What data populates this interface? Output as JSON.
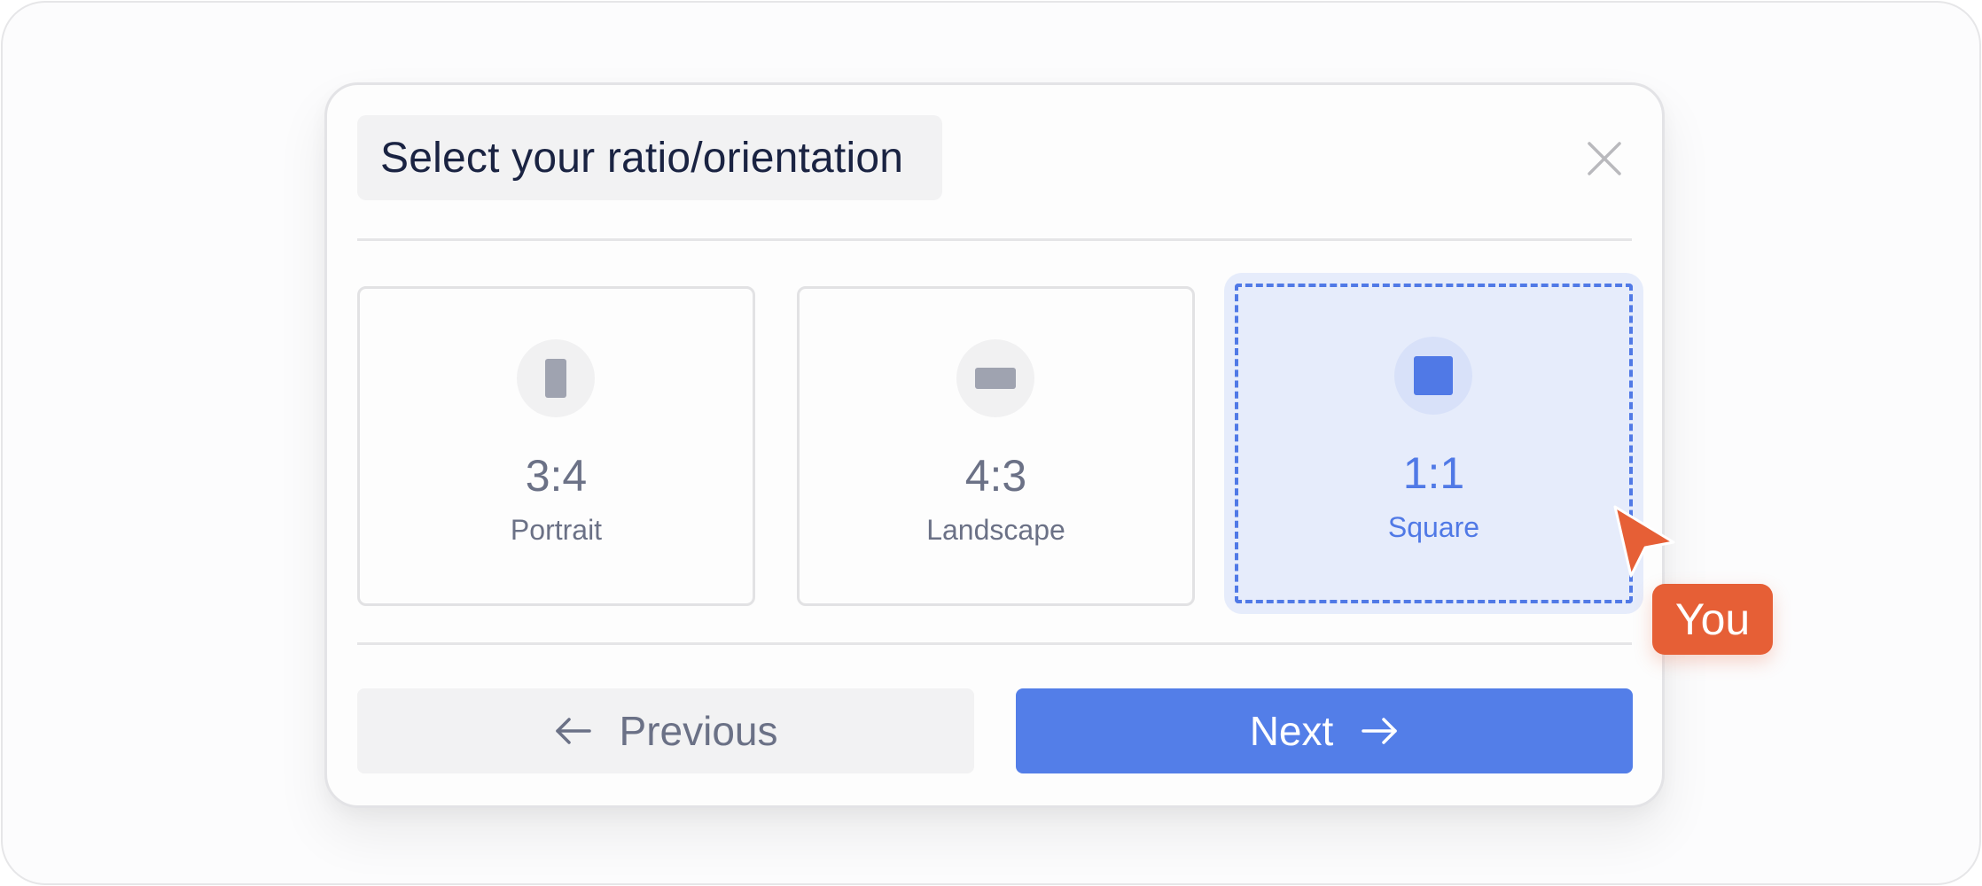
{
  "dialog": {
    "title": "Select your ratio/orientation",
    "close_icon": "close-icon"
  },
  "options": [
    {
      "ratio": "3:4",
      "label": "Portrait",
      "icon": "portrait-rect-icon",
      "selected": false
    },
    {
      "ratio": "4:3",
      "label": "Landscape",
      "icon": "landscape-rect-icon",
      "selected": false
    },
    {
      "ratio": "1:1",
      "label": "Square",
      "icon": "square-icon",
      "selected": true
    }
  ],
  "footer": {
    "previous_label": "Previous",
    "previous_icon": "arrow-left-icon",
    "next_label": "Next",
    "next_icon": "arrow-right-icon"
  },
  "cursor": {
    "tag_label": "You",
    "icon": "pointer-cursor-icon"
  },
  "colors": {
    "accent": "#537ee8",
    "selected_bg": "#e6ecfb",
    "cursor": "#e65f36",
    "title_text": "#1a2342",
    "muted_text": "#6b7186"
  }
}
